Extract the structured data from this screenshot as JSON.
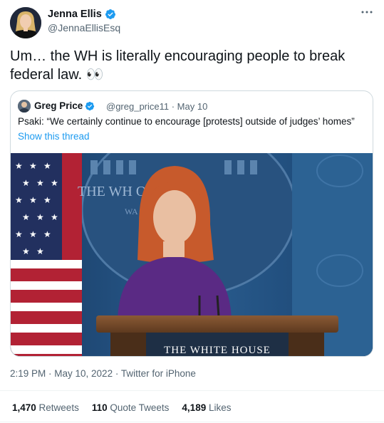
{
  "tweet": {
    "author_name": "Jenna Ellis",
    "author_handle": "@JennaEllisEsq",
    "text": "Um… the WH is literally encouraging people to break federal law. 👀",
    "more_icon": "more-dots-icon",
    "verified_icon": "verified-badge-icon",
    "verified_color": "#1d9bf0"
  },
  "quote": {
    "author_name": "Greg Price",
    "author_handle": "@greg_price11",
    "date": "May 10",
    "meta": "@greg_price11 · May 10",
    "text": "Psaki: “We certainly continue to encourage [protests] outside of judges’ homes”",
    "thread_link": "Show this thread",
    "video": {
      "backdrop_text": "THE WH         OUSE",
      "backdrop_sub": "WA",
      "podium_text": "THE WHITE HOUSE"
    }
  },
  "footer": {
    "timestamp": "2:19 PM · May 10, 2022 · Twitter for iPhone",
    "retweets_count": "1,470",
    "retweets_label": "Retweets",
    "quotes_count": "110",
    "quotes_label": "Quote Tweets",
    "likes_count": "4,189",
    "likes_label": "Likes"
  },
  "colors": {
    "link": "#1d9bf0",
    "muted": "#536471",
    "border": "#cfd9de"
  }
}
